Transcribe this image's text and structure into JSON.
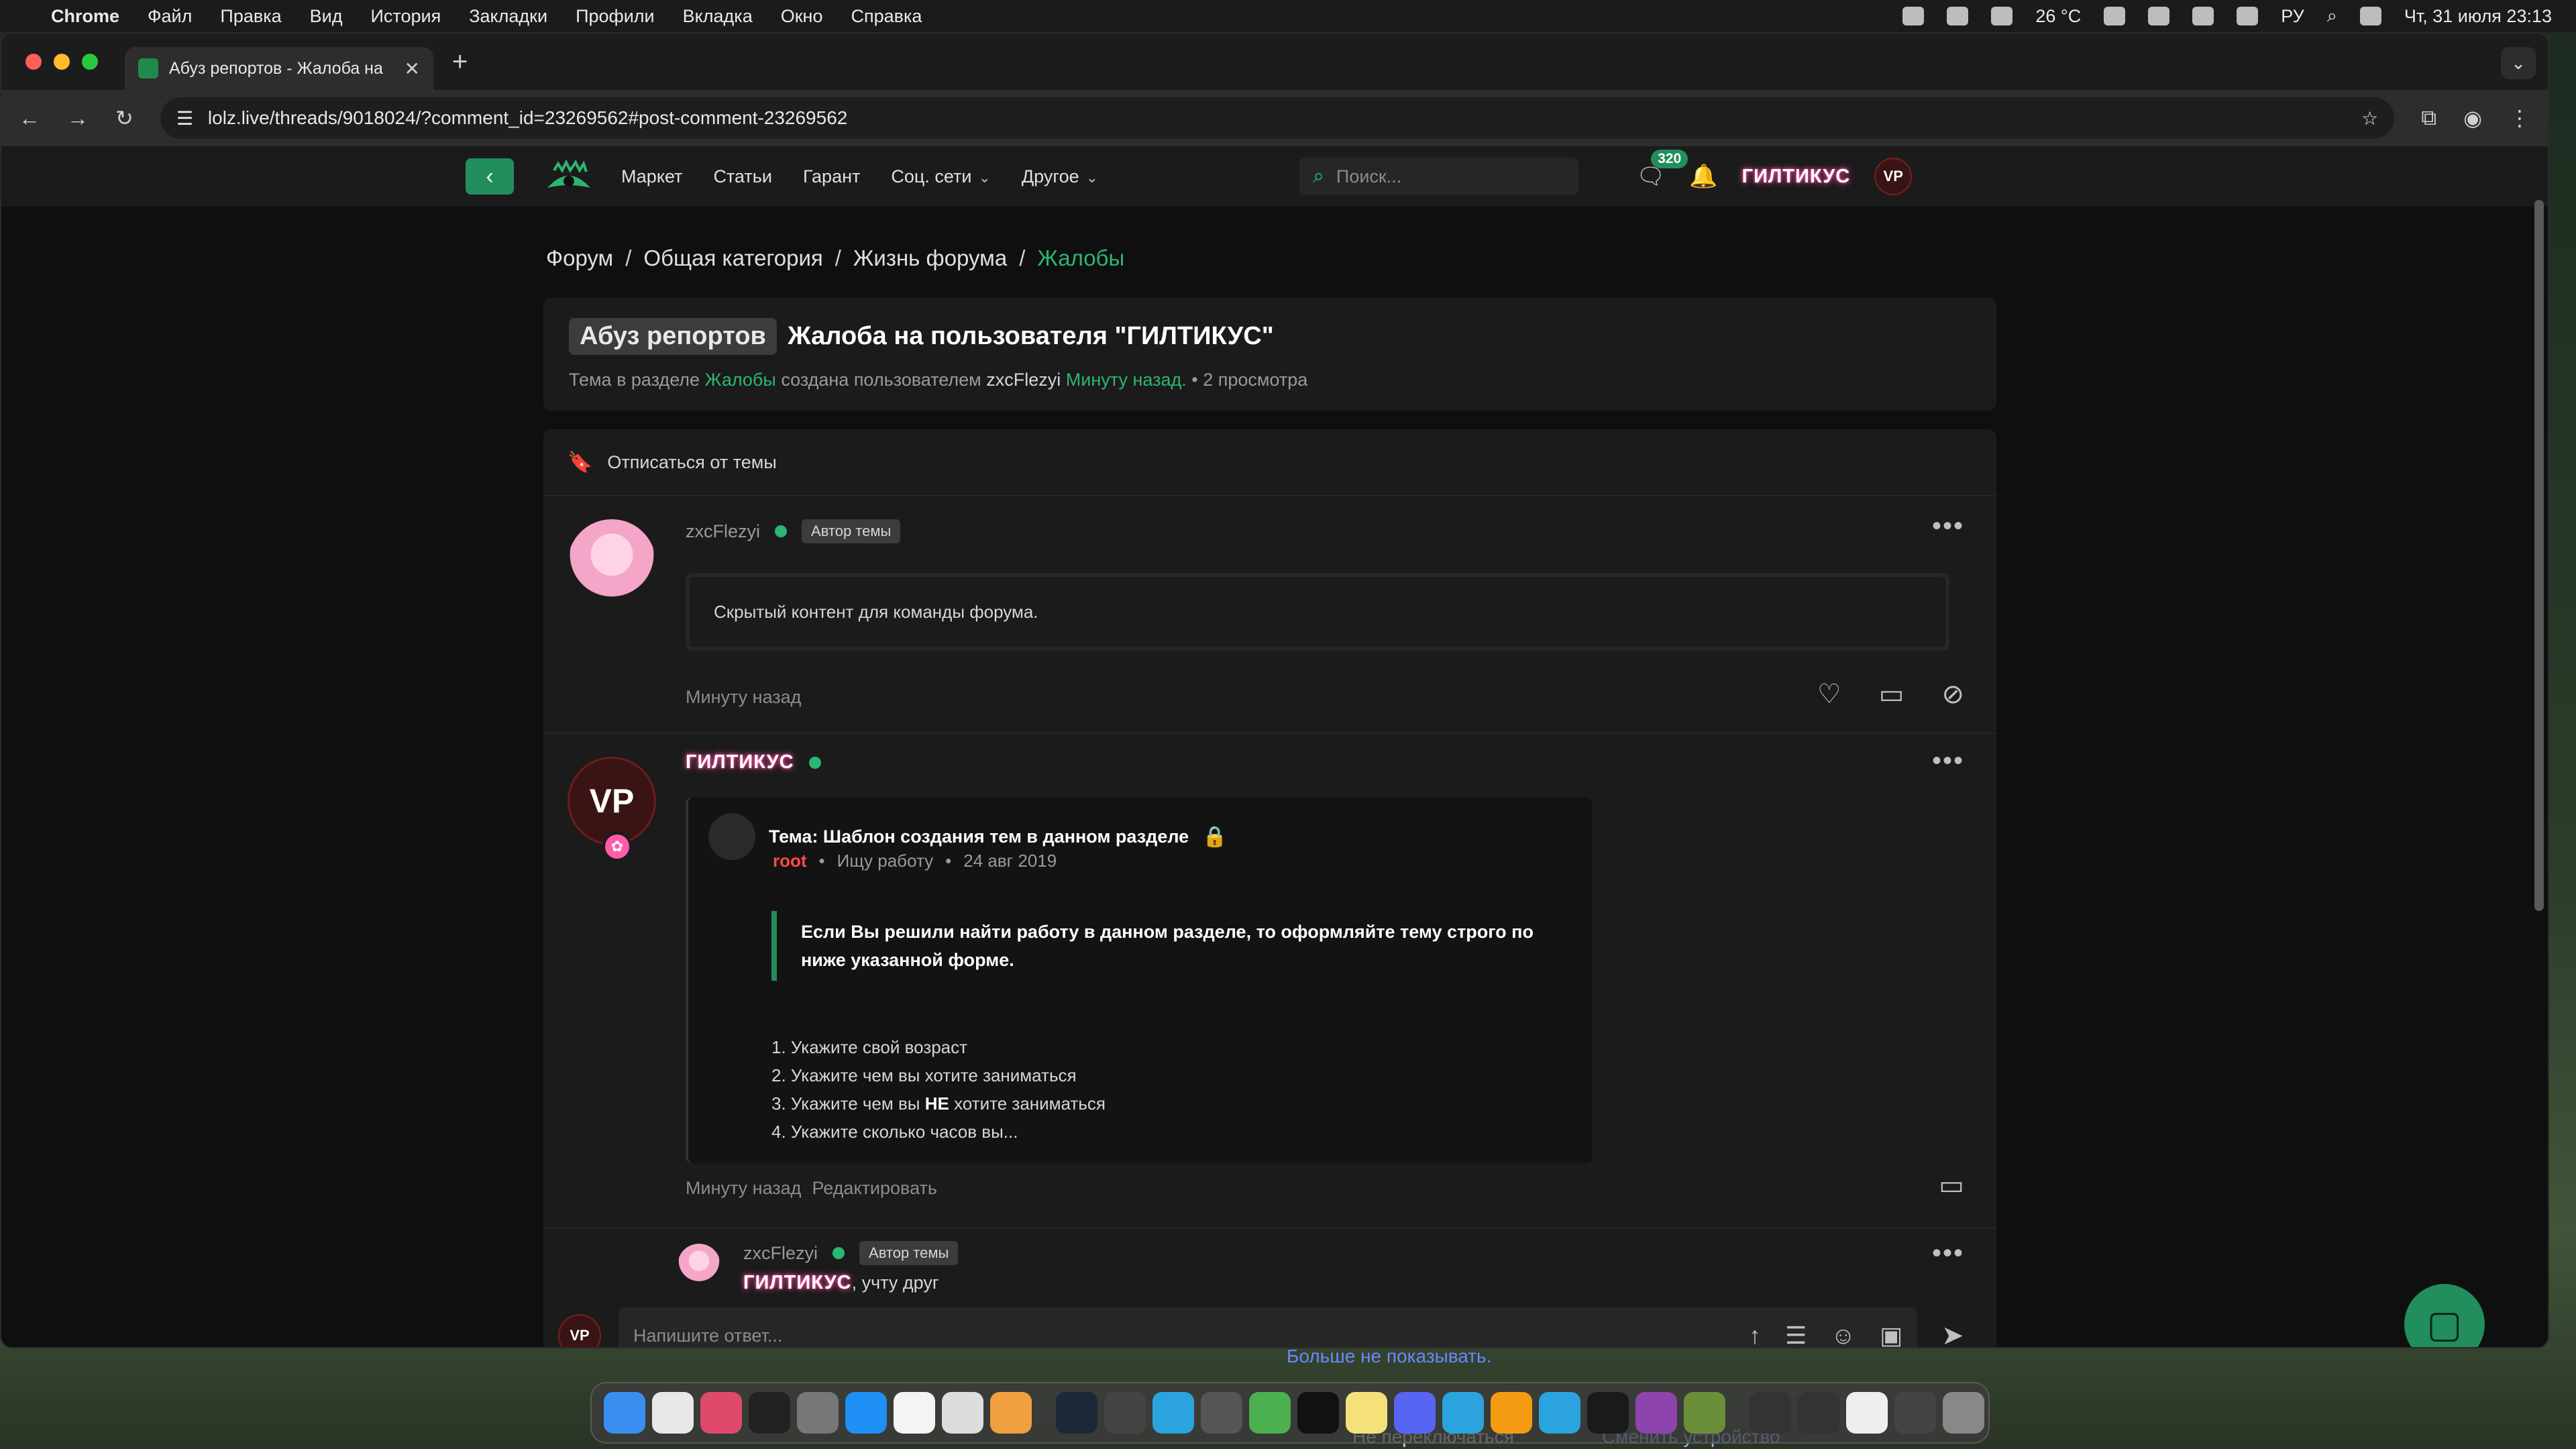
{
  "menubar": {
    "app": "Chrome",
    "items": [
      "Файл",
      "Правка",
      "Вид",
      "История",
      "Закладки",
      "Профили",
      "Вкладка",
      "Окно",
      "Справка"
    ],
    "weather": "26 °C",
    "input_lang": "РУ",
    "clock": "Чт, 31 июля  23:13"
  },
  "browser": {
    "tab_title": "Абуз репортов - Жалоба на",
    "url": "lolz.live/threads/9018024/?comment_id=23269562#post-comment-23269562"
  },
  "nav": {
    "links": [
      "Маркет",
      "Статьи",
      "Гарант",
      "Соц. сети",
      "Другое"
    ],
    "search_placeholder": "Поиск...",
    "messages_count": "320",
    "username": "ГИЛТИКУС",
    "avatar_text": "VP"
  },
  "breadcrumbs": [
    "Форум",
    "Общая категория",
    "Жизнь форума",
    "Жалобы"
  ],
  "thread": {
    "prefix": "Абуз репортов",
    "title": "Жалоба на пользователя \"ГИЛТИКУС\"",
    "meta_prefix": "Тема в разделе",
    "section": "Жалобы",
    "meta_created": "создана пользователем",
    "author": "zxcFlezyi",
    "time": "Минуту назад.",
    "views": "• 2 просмотра"
  },
  "unsubscribe": "Отписаться от темы",
  "posts": [
    {
      "user": "zxcFlezyi",
      "badge": "Автор темы",
      "content": "Скрытый контент для команды форума.",
      "time": "Минуту назад"
    },
    {
      "user": "ГИЛТИКУС",
      "quote": {
        "title": "Тема: Шаблон создания тем в данном разделе",
        "author": "root",
        "status": "Ищу работу",
        "date": "24 авг 2019",
        "block": "Если Вы решили найти работу в данном разделе, то оформляйте тему строго по ниже указанной форме.",
        "list": [
          "1. Укажите свой возраст",
          "2. Укажите чем вы хотите заниматься",
          "3. Укажите чем вы",
          "НЕ",
          "хотите заниматься",
          "4. Укажите сколько часов вы..."
        ]
      },
      "time": "Минуту назад",
      "edit": "Редактировать"
    }
  ],
  "reply": {
    "user": "zxcFlezyi",
    "badge": "Автор темы",
    "mention": "ГИЛТИКУС",
    "text": ", учту друг"
  },
  "composer": {
    "placeholder": "Напишите ответ..."
  },
  "behind": {
    "dont_show": "Больше не показывать.",
    "no_switch": "Не переключаться",
    "change_device": "Сменить устройство"
  },
  "colors": {
    "accent": "#228e5d",
    "accent_text": "#2bb673",
    "page_bg": "#0f0f0f",
    "card_bg": "#1b1b1b"
  }
}
